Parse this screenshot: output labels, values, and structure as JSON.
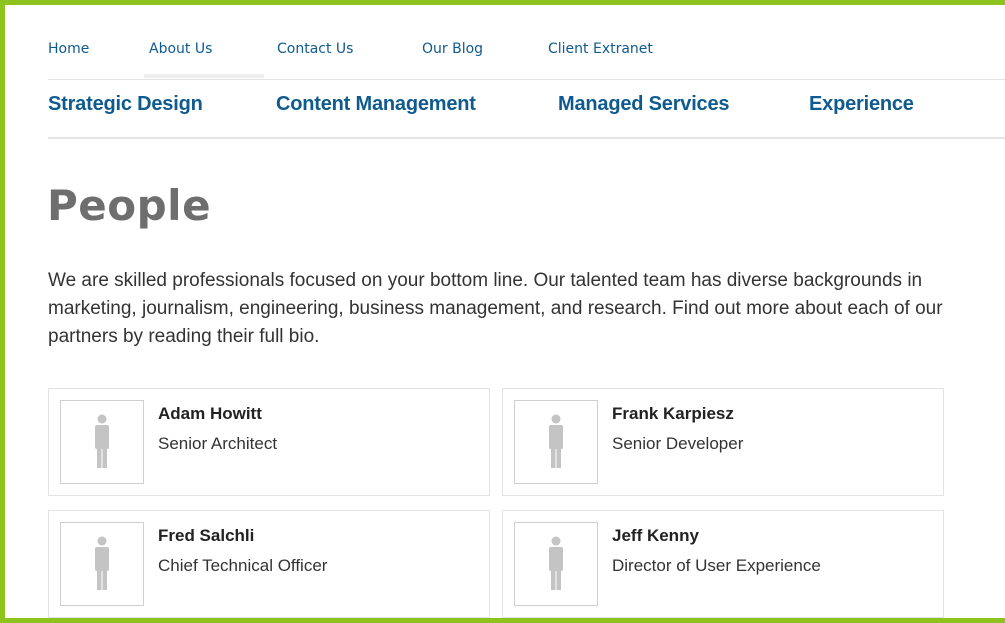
{
  "top_nav": {
    "items": [
      {
        "label": "Home"
      },
      {
        "label": "About Us"
      },
      {
        "label": "Contact Us"
      },
      {
        "label": "Our Blog"
      },
      {
        "label": "Client Extranet"
      }
    ],
    "active": "About Us"
  },
  "main_nav": {
    "items": [
      {
        "label": "Strategic Design"
      },
      {
        "label": "Content Management"
      },
      {
        "label": "Managed Services"
      },
      {
        "label": "Experience"
      }
    ]
  },
  "page": {
    "title": "People",
    "intro": "We are skilled professionals focused on your bottom line. Our talented team has diverse backgrounds in marketing, journalism, engineering, business management, and research. Find out more about each of our partners by reading their full bio."
  },
  "people": [
    {
      "name": "Adam Howitt",
      "role": "Senior Architect",
      "photo_icon": "person-silhouette-icon"
    },
    {
      "name": "Frank Karpiesz",
      "role": "Senior Developer",
      "photo_icon": "person-silhouette-icon"
    },
    {
      "name": "Fred Salchli",
      "role": "Chief Technical Officer",
      "photo_icon": "person-silhouette-icon"
    },
    {
      "name": "Jeff Kenny",
      "role": "Director of User Experience",
      "photo_icon": "person-silhouette-icon"
    }
  ],
  "colors": {
    "frame_border": "#8dc21f",
    "link": "#0f5a8e",
    "title": "#6e6e6e",
    "silhouette": "#c4c4c4"
  }
}
